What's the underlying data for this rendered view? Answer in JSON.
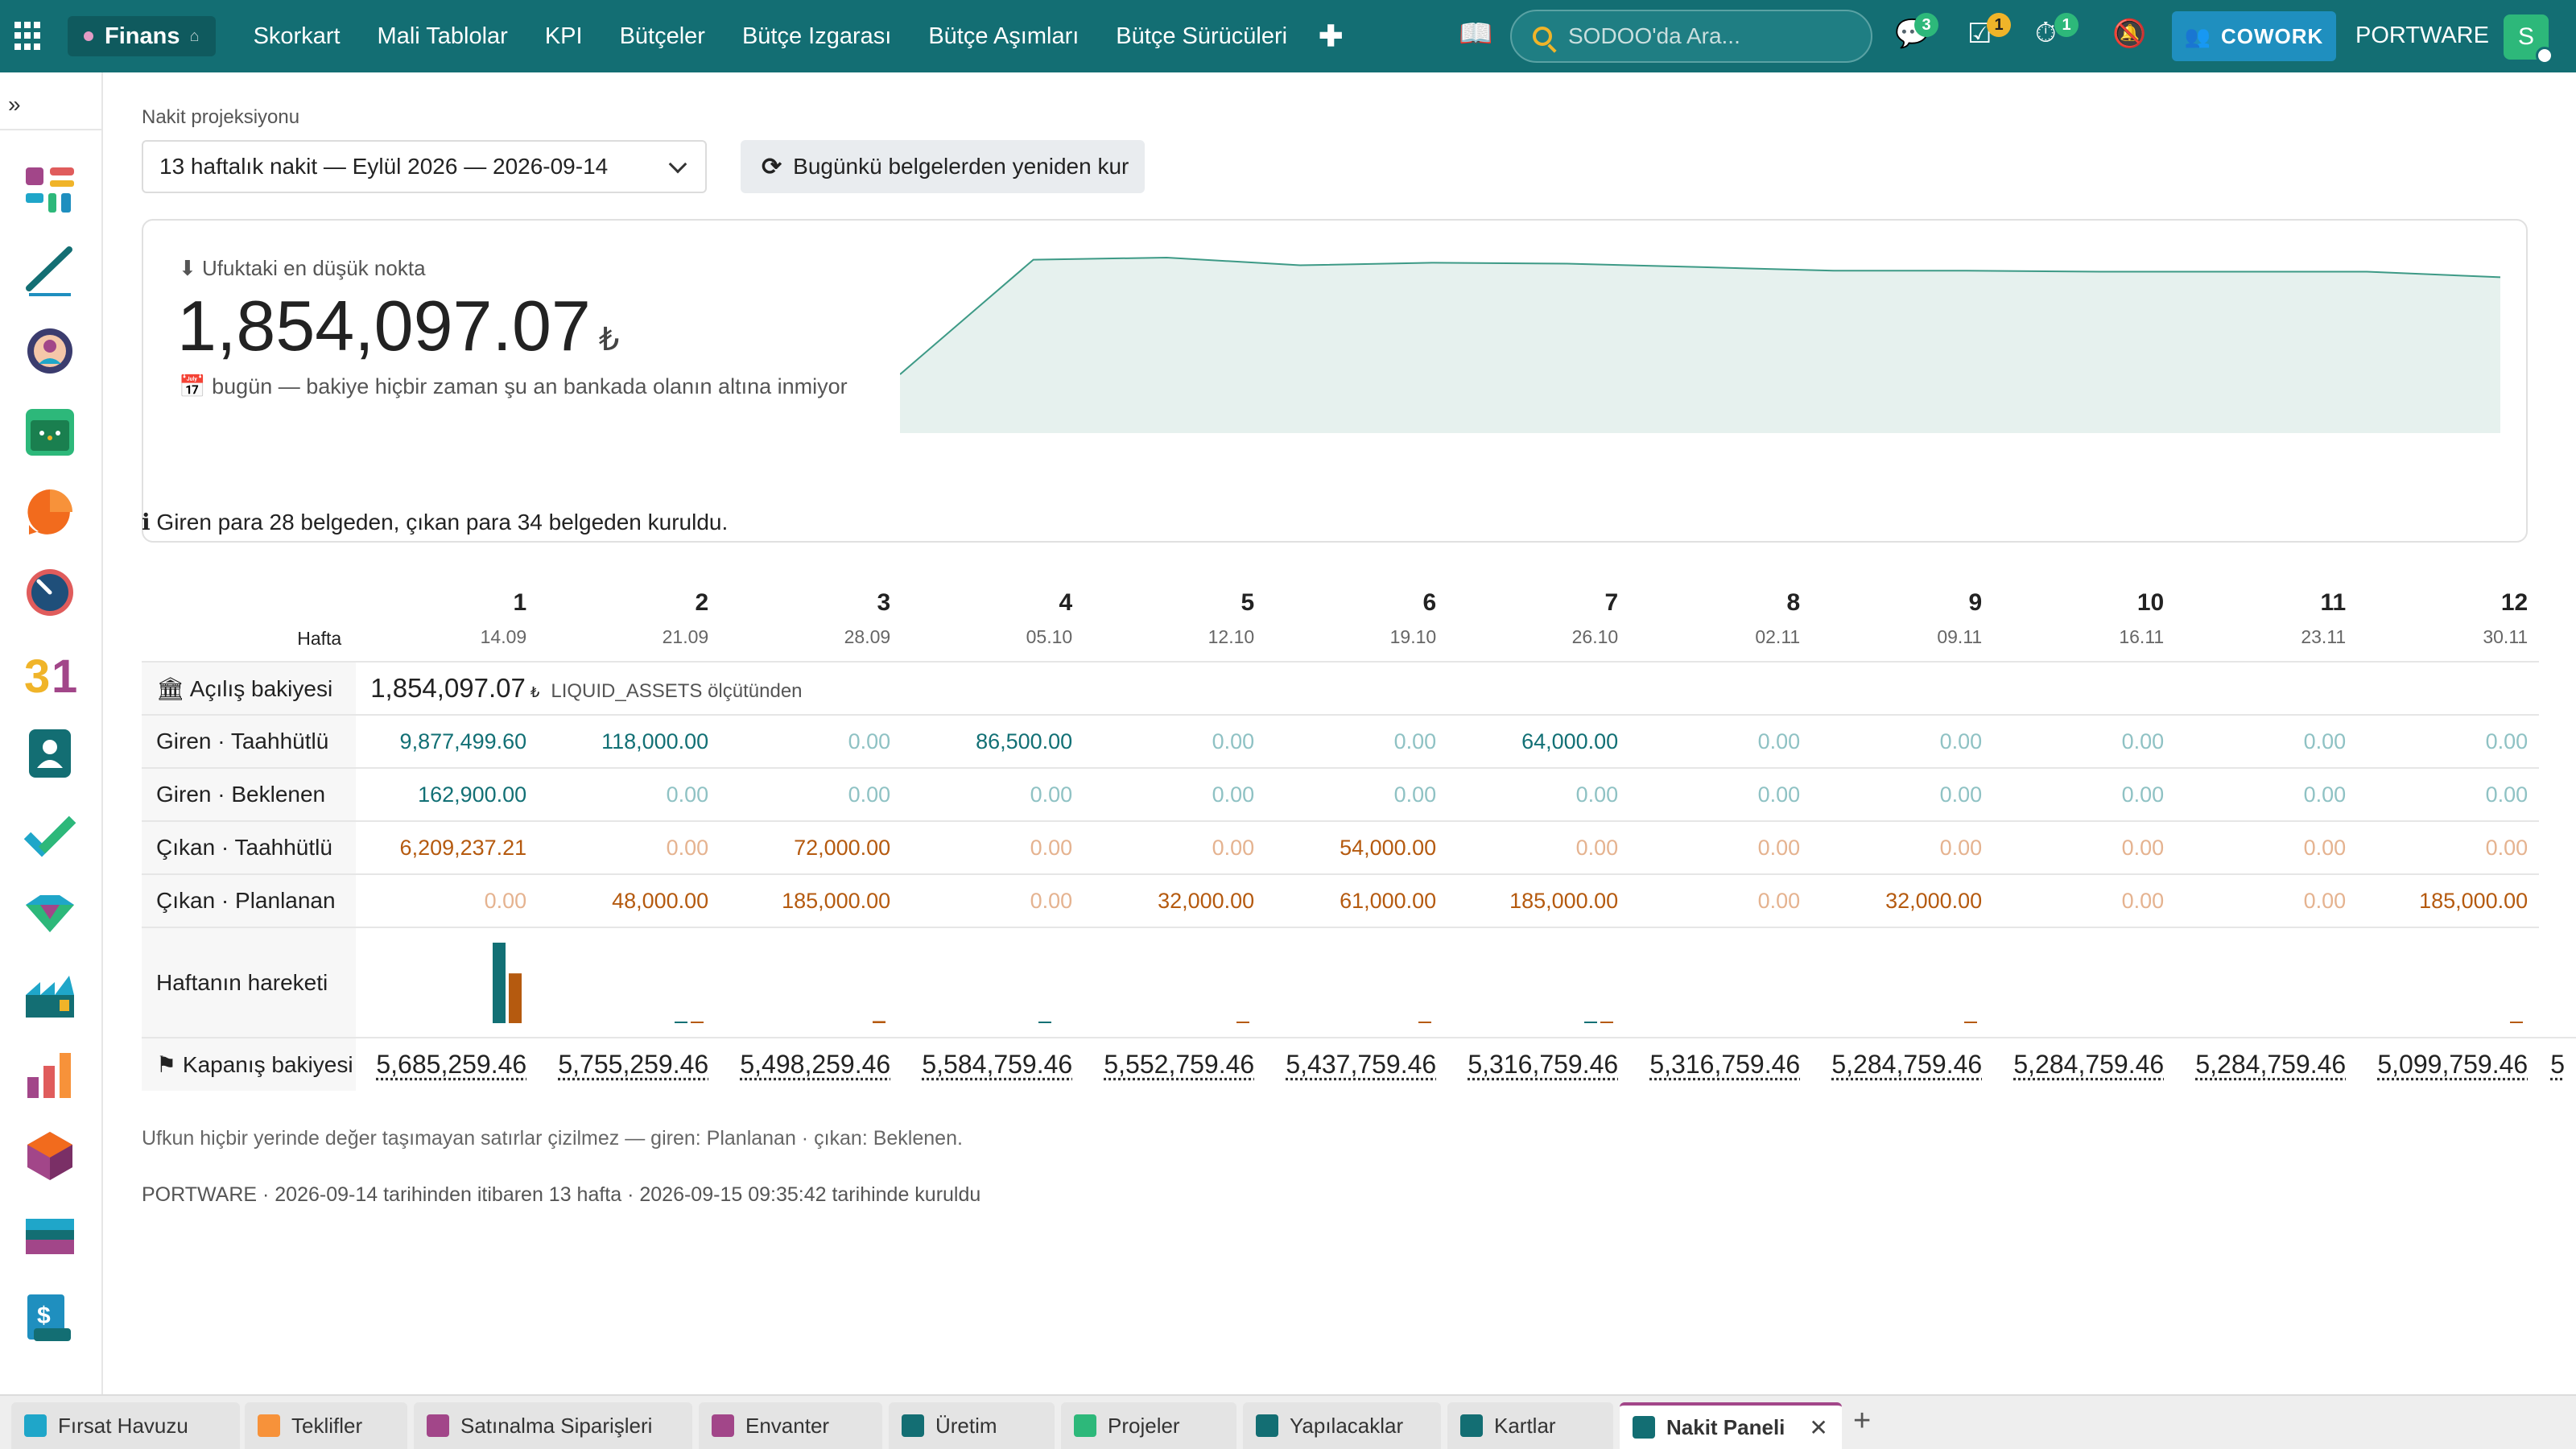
{
  "topbar": {
    "app_name": "Finans",
    "menu": [
      "Skorkart",
      "Mali Tablolar",
      "KPI",
      "Bütçeler",
      "Bütçe Izgarası",
      "Bütçe Aşımları",
      "Bütçe Sürücüleri"
    ],
    "search_placeholder": "SODOO'da Ara...",
    "badges": {
      "messages": "3",
      "activities": "1",
      "timer": "1"
    },
    "cowork_label": "COWORK",
    "company": "PORTWARE",
    "avatar_letter": "S",
    "colors": {
      "bar": "#136e73",
      "cowork": "#1f8fbf"
    }
  },
  "projection": {
    "label": "Nakit projeksiyonu",
    "selected": "13 haftalık nakit — Eylül 2026 — 2026-09-14",
    "rebuild_label": "Bugünkü belgelerden yeniden kur"
  },
  "summary": {
    "low_label": "Ufuktaki en düşük nokta",
    "low_value": "1,854,097.07",
    "currency": "₺",
    "low_note": "bugün — bakiye hiçbir zaman şu an bankada olanın altına inmiyor"
  },
  "info_text": "Giren para 28 belgeden, çıkan para 34 belgeden kuruldu.",
  "table": {
    "week_header": "Hafta",
    "weeks": [
      {
        "n": "1",
        "d": "14.09"
      },
      {
        "n": "2",
        "d": "21.09"
      },
      {
        "n": "3",
        "d": "28.09"
      },
      {
        "n": "4",
        "d": "05.10"
      },
      {
        "n": "5",
        "d": "12.10"
      },
      {
        "n": "6",
        "d": "19.10"
      },
      {
        "n": "7",
        "d": "26.10"
      },
      {
        "n": "8",
        "d": "02.11"
      },
      {
        "n": "9",
        "d": "09.11"
      },
      {
        "n": "10",
        "d": "16.11"
      },
      {
        "n": "11",
        "d": "23.11"
      },
      {
        "n": "12",
        "d": "30.11"
      }
    ],
    "opening": {
      "label": "Açılış bakiyesi",
      "value": "1,854,097.07",
      "currency": "₺",
      "source": "LIQUID_ASSETS ölçütünden"
    },
    "rows": [
      {
        "label": "Giren · Taahhütlü",
        "kind": "in",
        "values": [
          "9,877,499.60",
          "118,000.00",
          "0.00",
          "86,500.00",
          "0.00",
          "0.00",
          "64,000.00",
          "0.00",
          "0.00",
          "0.00",
          "0.00",
          "0.00"
        ]
      },
      {
        "label": "Giren · Beklenen",
        "kind": "in",
        "values": [
          "162,900.00",
          "0.00",
          "0.00",
          "0.00",
          "0.00",
          "0.00",
          "0.00",
          "0.00",
          "0.00",
          "0.00",
          "0.00",
          "0.00"
        ]
      },
      {
        "label": "Çıkan · Taahhütlü",
        "kind": "out",
        "values": [
          "6,209,237.21",
          "0.00",
          "72,000.00",
          "0.00",
          "0.00",
          "54,000.00",
          "0.00",
          "0.00",
          "0.00",
          "0.00",
          "0.00",
          "0.00"
        ]
      },
      {
        "label": "Çıkan · Planlanan",
        "kind": "out",
        "values": [
          "0.00",
          "48,000.00",
          "185,000.00",
          "0.00",
          "32,000.00",
          "61,000.00",
          "185,000.00",
          "0.00",
          "32,000.00",
          "0.00",
          "0.00",
          "185,000.00"
        ]
      }
    ],
    "movement_label": "Haftanın hareketi",
    "movement": {
      "in": [
        10040399.6,
        118000,
        0,
        86500,
        0,
        0,
        64000,
        0,
        0,
        0,
        0,
        0
      ],
      "out": [
        6209237.21,
        48000,
        257000,
        0,
        32000,
        115000,
        185000,
        0,
        32000,
        0,
        0,
        185000
      ]
    },
    "closing": {
      "label": "Kapanış bakiyesi",
      "values": [
        "5,685,259.46",
        "5,755,259.46",
        "5,498,259.46",
        "5,584,759.46",
        "5,552,759.46",
        "5,437,759.46",
        "5,316,759.46",
        "5,316,759.46",
        "5,284,759.46",
        "5,284,759.46",
        "5,284,759.46",
        "5,099,759.46"
      ],
      "partial_next": "5"
    },
    "colors": {
      "in": "#127075",
      "out": "#b55a0f"
    }
  },
  "chart_data": {
    "type": "area",
    "x": [
      "bugün",
      "1",
      "2",
      "3",
      "4",
      "5",
      "6",
      "7",
      "8",
      "9",
      "10",
      "11",
      "12"
    ],
    "values": [
      1854097.07,
      5685259.46,
      5755259.46,
      5498259.46,
      5584759.46,
      5552759.46,
      5437759.46,
      5316759.46,
      5316759.46,
      5284759.46,
      5284759.46,
      5284759.46,
      5099759.46
    ],
    "color": "#3d9a86",
    "fill": "#e6f1ee"
  },
  "footer": {
    "note": "Ufkun hiçbir yerinde değer taşımayan satırlar çizilmez — giren: Planlanan · çıkan: Beklenen.",
    "meta": "PORTWARE · 2026-09-14 tarihinden itibaren 13 hafta · 2026-09-15 09:35:42 tarihinde kuruldu"
  },
  "tabs": [
    {
      "label": "Fırsat Havuzu",
      "icon": "crm-icon"
    },
    {
      "label": "Teklifler",
      "icon": "sales-icon"
    },
    {
      "label": "Satınalma Siparişleri",
      "icon": "purchase-icon"
    },
    {
      "label": "Envanter",
      "icon": "inventory-icon"
    },
    {
      "label": "Üretim",
      "icon": "manufacturing-icon"
    },
    {
      "label": "Projeler",
      "icon": "project-icon"
    },
    {
      "label": "Yapılacaklar",
      "icon": "todo-icon"
    },
    {
      "label": "Kartlar",
      "icon": "cards-icon"
    },
    {
      "label": "Nakit Paneli",
      "icon": "cash-panel-icon",
      "active": true
    }
  ]
}
